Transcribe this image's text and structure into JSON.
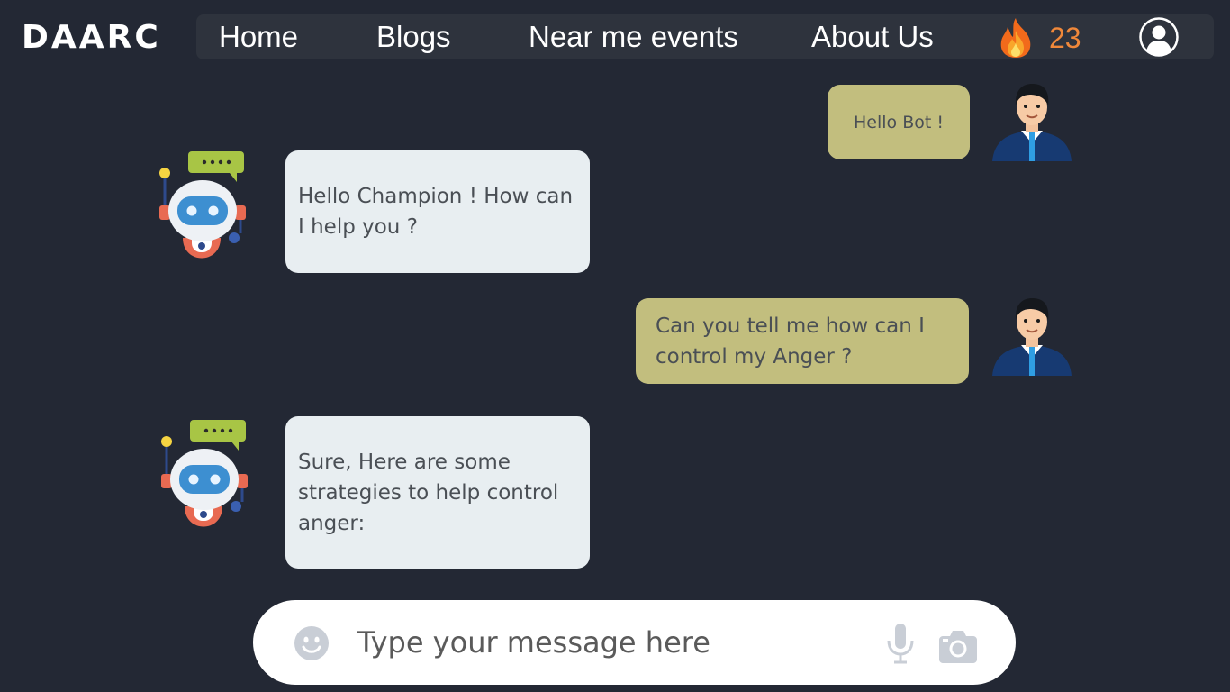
{
  "brand": {
    "logo_text": "DAARC"
  },
  "nav": {
    "items": [
      {
        "label": "Home"
      },
      {
        "label": "Blogs"
      },
      {
        "label": "Near me events"
      },
      {
        "label": "About Us"
      }
    ],
    "streak": {
      "icon": "fire-icon",
      "count": "23",
      "color": "#f0883a"
    },
    "profile_icon": "user-circle-icon"
  },
  "chat": {
    "messages": [
      {
        "sender": "user",
        "text": "Hello Bot !"
      },
      {
        "sender": "bot",
        "text": "Hello Champion ! How can I help you ?"
      },
      {
        "sender": "user",
        "text": "Can you tell me how can I control my Anger ?"
      },
      {
        "sender": "bot",
        "text": "Sure, Here are some strategies to help control anger:"
      }
    ],
    "colors": {
      "user_bubble": "#c2be7e",
      "bot_bubble": "#e8eef1",
      "background": "#232834"
    }
  },
  "composer": {
    "placeholder": "Type your message here",
    "value": "",
    "icons": [
      "smiley-icon",
      "microphone-icon",
      "camera-icon"
    ]
  }
}
